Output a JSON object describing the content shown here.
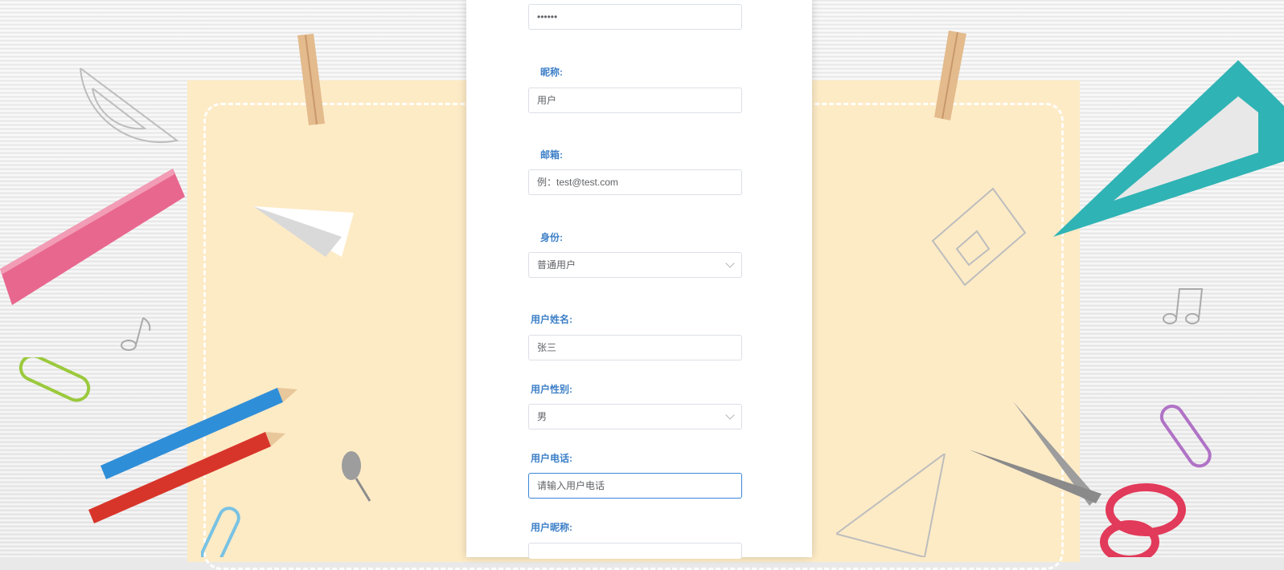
{
  "form": {
    "password": {
      "value": "••••••"
    },
    "nickname": {
      "label": "昵称:",
      "value": "用户"
    },
    "email": {
      "label": "邮箱:",
      "placeholder": "例：test@test.com"
    },
    "identity": {
      "label": "身份:",
      "value": "普通用户"
    },
    "real_name": {
      "label": "用户姓名:",
      "value": "张三"
    },
    "gender": {
      "label": "用户性别:",
      "value": "男"
    },
    "phone": {
      "label": "用户电话:",
      "placeholder": "请输入用户电话"
    },
    "next_label": "用户昵称:"
  },
  "colors": {
    "label": "#3c7fc7",
    "paper": "#fdebc6",
    "ruler": "#e8678f",
    "triangle": "#2fb3b5",
    "pencil_blue": "#2f8ed8",
    "pencil_red": "#d8352a",
    "scissors_handle": "#e23a5a"
  },
  "icons": [
    "protractor-icon",
    "ruler-icon",
    "paper-plane-icon",
    "clothespin-icon",
    "music-note-icon",
    "paperclip-icon",
    "pencil-icon",
    "pushpin-icon",
    "set-square-icon",
    "scissors-icon",
    "eraser-icon",
    "chevron-down-icon"
  ]
}
